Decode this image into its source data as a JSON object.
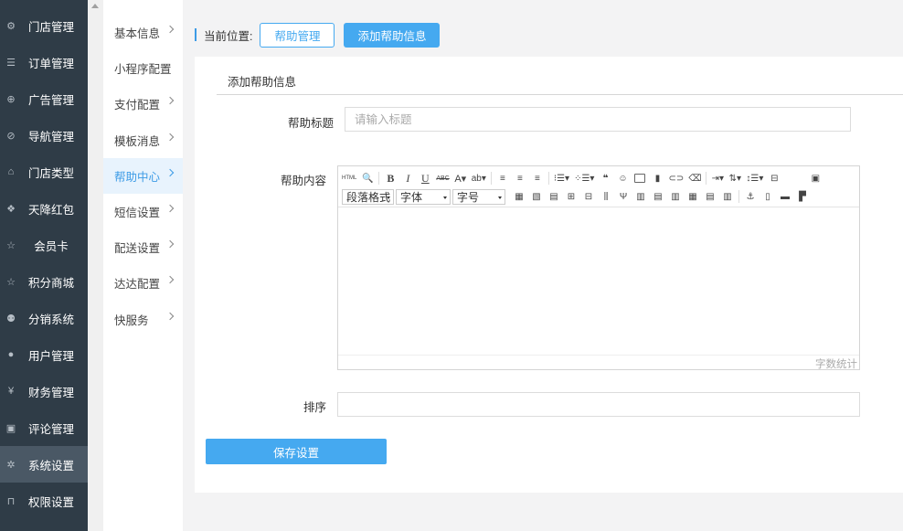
{
  "sidebar": {
    "items": [
      {
        "label": "门店管理",
        "icon": "stores-icon",
        "glyph": "⚙"
      },
      {
        "label": "订单管理",
        "icon": "list-icon",
        "glyph": "☰"
      },
      {
        "label": "广告管理",
        "icon": "globe-icon",
        "glyph": "⊕"
      },
      {
        "label": "导航管理",
        "icon": "compass-icon",
        "glyph": "⊘"
      },
      {
        "label": "门店类型",
        "icon": "bank-icon",
        "glyph": "⌂"
      },
      {
        "label": "天降红包",
        "icon": "cubes-icon",
        "glyph": "❖"
      },
      {
        "label": "会员卡",
        "icon": "star-icon",
        "glyph": "☆"
      },
      {
        "label": "积分商城",
        "icon": "star-icon",
        "glyph": "☆"
      },
      {
        "label": "分销系统",
        "icon": "users-icon",
        "glyph": "⚉"
      },
      {
        "label": "用户管理",
        "icon": "user-icon",
        "glyph": "●"
      },
      {
        "label": "财务管理",
        "icon": "yen-icon",
        "glyph": "¥"
      },
      {
        "label": "评论管理",
        "icon": "money-icon",
        "glyph": "▣"
      },
      {
        "label": "系统设置",
        "icon": "gear-icon",
        "glyph": "✲"
      },
      {
        "label": "权限设置",
        "icon": "lock-icon",
        "glyph": "🔓"
      }
    ]
  },
  "submenu": {
    "items": [
      {
        "label": "基本信息",
        "chevron": true
      },
      {
        "label": "小程序配置",
        "chevron": false
      },
      {
        "label": "支付配置",
        "chevron": true
      },
      {
        "label": "模板消息",
        "chevron": true
      },
      {
        "label": "帮助中心",
        "chevron": true
      },
      {
        "label": "短信设置",
        "chevron": true
      },
      {
        "label": "配送设置",
        "chevron": true
      },
      {
        "label": "达达配置",
        "chevron": true
      },
      {
        "label": "快服务",
        "chevron": true
      }
    ]
  },
  "breadcrumb": {
    "label": "当前位置:",
    "link": "帮助管理",
    "current": "添加帮助信息"
  },
  "form": {
    "section_title": "添加帮助信息",
    "title_label": "帮助标题",
    "title_placeholder": "请输入标题",
    "title_value": "",
    "content_label": "帮助内容",
    "paragraph_select": "段落格式",
    "font_select": "字体",
    "size_select": "字号",
    "word_count": "字数统计",
    "sort_label": "排序",
    "sort_value": "",
    "save_label": "保存设置"
  },
  "colors": {
    "sidebar_bg": "#2f3c47",
    "accent": "#45a9f0",
    "active_sub_bg": "#e8f3fd"
  }
}
